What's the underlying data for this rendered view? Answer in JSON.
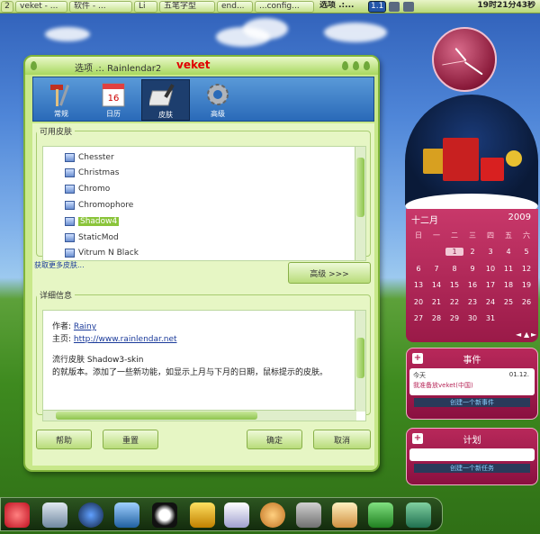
{
  "taskbar": {
    "pager": "2",
    "items": [
      "veket - ...",
      "软件 - ...",
      "Li",
      "五笔字型",
      "end...",
      "...config...",
      "选项 .:..."
    ],
    "workspace": "1.1",
    "clock": "19时21分43秒"
  },
  "window": {
    "title": "选项 .:. Rainlendar2",
    "brand": "veket",
    "tools": [
      {
        "label": "常规",
        "icon": "tools-icon"
      },
      {
        "label": "日历",
        "icon": "calendar-icon"
      },
      {
        "label": "皮肤",
        "icon": "skin-icon"
      },
      {
        "label": "高级",
        "icon": "gear-icon"
      }
    ],
    "skins_legend": "可用皮肤",
    "skins": [
      {
        "name": "Chesster",
        "checked": true
      },
      {
        "name": "Christmas",
        "checked": true
      },
      {
        "name": "Chromo",
        "checked": true
      },
      {
        "name": "Chromophore",
        "checked": true
      },
      {
        "name": "Shadow4",
        "checked": true,
        "selected": true
      },
      {
        "name": "StaticMod",
        "checked": true
      },
      {
        "name": "Vitrum N Black",
        "checked": true
      }
    ],
    "get_more": "获取更多皮肤...",
    "advanced_button": "高级 >>>",
    "detail_legend": "详细信息",
    "detail": {
      "author_label": "作者:",
      "author": "Rainy",
      "homepage_label": "主页:",
      "homepage": "http://www.rainlendar.net",
      "skin_line": "流行皮肤 Shadow3-skin",
      "desc_line": "的就版本。添加了一些新功能，如显示上月与下月的日期，鼠标提示的皮肤。"
    },
    "buttons": {
      "help": "帮助",
      "reset": "重置",
      "ok": "确定",
      "cancel": "取消"
    }
  },
  "calendar": {
    "month": "十二月",
    "year": "2009",
    "weekdays": [
      "日",
      "一",
      "二",
      "三",
      "四",
      "五",
      "六"
    ],
    "weeks": [
      [
        "",
        "",
        "1",
        "2",
        "3",
        "4",
        "5"
      ],
      [
        "6",
        "7",
        "8",
        "9",
        "10",
        "11",
        "12"
      ],
      [
        "13",
        "14",
        "15",
        "16",
        "17",
        "18",
        "19"
      ],
      [
        "20",
        "21",
        "22",
        "23",
        "24",
        "25",
        "26"
      ],
      [
        "27",
        "28",
        "29",
        "30",
        "31",
        "",
        ""
      ]
    ],
    "today": "1"
  },
  "events": {
    "title": "事件",
    "item_day": "今天",
    "item_date": "01.12.",
    "item_text": "我准备放veket(中国)",
    "create_link": "创建一个新事件"
  },
  "plan": {
    "title": "计划",
    "create_link": "创建一个新任务"
  },
  "colors": {
    "window_bg": "#c8e88a",
    "toolbar_blue": "#2a6ab8",
    "selected_skin": "#8ac43a",
    "calendar_bg": "#b8285a",
    "brand_red": "#e00000"
  }
}
